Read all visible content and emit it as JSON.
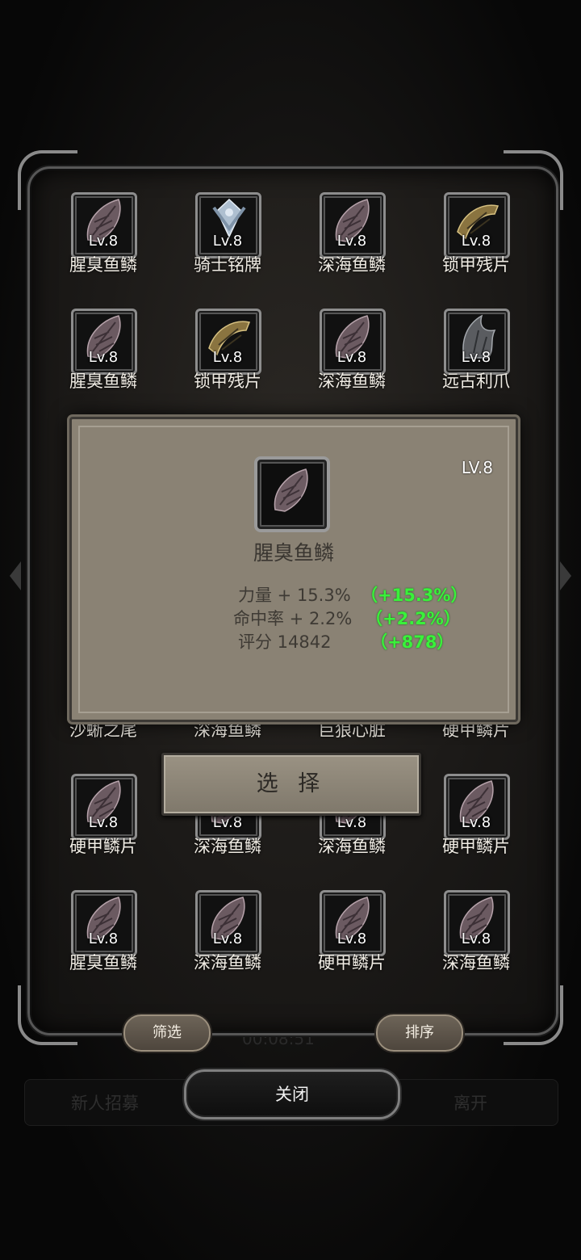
{
  "background": {
    "recruit_label": "新人招募",
    "leave_label": "离开",
    "timer": "00:08:51"
  },
  "grid": [
    {
      "name": "腥臭鱼鳞",
      "level": "Lv.8",
      "icon": "fish-scale-icon"
    },
    {
      "name": "骑士铭牌",
      "level": "Lv.8",
      "icon": "knight-badge-icon"
    },
    {
      "name": "深海鱼鳞",
      "level": "Lv.8",
      "icon": "fish-scale-icon"
    },
    {
      "name": "锁甲残片",
      "level": "Lv.8",
      "icon": "chain-armor-fragment-icon"
    },
    {
      "name": "腥臭鱼鳞",
      "level": "Lv.8",
      "icon": "fish-scale-icon"
    },
    {
      "name": "锁甲残片",
      "level": "Lv.8",
      "icon": "chain-armor-fragment-icon"
    },
    {
      "name": "深海鱼鳞",
      "level": "Lv.8",
      "icon": "fish-scale-icon"
    },
    {
      "name": "远古利爪",
      "level": "Lv.8",
      "icon": "ancient-claw-icon"
    },
    {
      "name": "沙蜥之尾",
      "level": "",
      "icon": ""
    },
    {
      "name": "深海鱼鳞",
      "level": "",
      "icon": ""
    },
    {
      "name": "巨狼心脏",
      "level": "",
      "icon": ""
    },
    {
      "name": "硬甲鳞片",
      "level": "",
      "icon": ""
    },
    {
      "name": "硬甲鳞片",
      "level": "Lv.8",
      "icon": "fish-scale-icon"
    },
    {
      "name": "深海鱼鳞",
      "level": "Lv.8",
      "icon": "fish-scale-icon"
    },
    {
      "name": "深海鱼鳞",
      "level": "Lv.8",
      "icon": "fish-scale-icon"
    },
    {
      "name": "硬甲鳞片",
      "level": "Lv.8",
      "icon": "fish-scale-icon"
    },
    {
      "name": "腥臭鱼鳞",
      "level": "Lv.8",
      "icon": "fish-scale-icon"
    },
    {
      "name": "深海鱼鳞",
      "level": "Lv.8",
      "icon": "fish-scale-icon"
    },
    {
      "name": "硬甲鳞片",
      "level": "Lv.8",
      "icon": "fish-scale-icon"
    },
    {
      "name": "深海鱼鳞",
      "level": "Lv.8",
      "icon": "fish-scale-icon"
    }
  ],
  "popup": {
    "level": "LV.8",
    "name": "腥臭鱼鳞",
    "icon": "fish-scale-icon",
    "stats": [
      {
        "label": "力量 + 15.3%",
        "bonus": "（+15.3%）"
      },
      {
        "label": "命中率 + 2.2%",
        "bonus": "（+2.2%）"
      },
      {
        "label": "评分 14842",
        "bonus": "（+878）"
      }
    ],
    "select_label": "选 择"
  },
  "buttons": {
    "filter": "筛选",
    "sort": "排序",
    "close": "关闭"
  },
  "colors": {
    "bonus_green": "#39f23a",
    "popup_bg": "#8a8274",
    "panel_border": "#575757"
  }
}
